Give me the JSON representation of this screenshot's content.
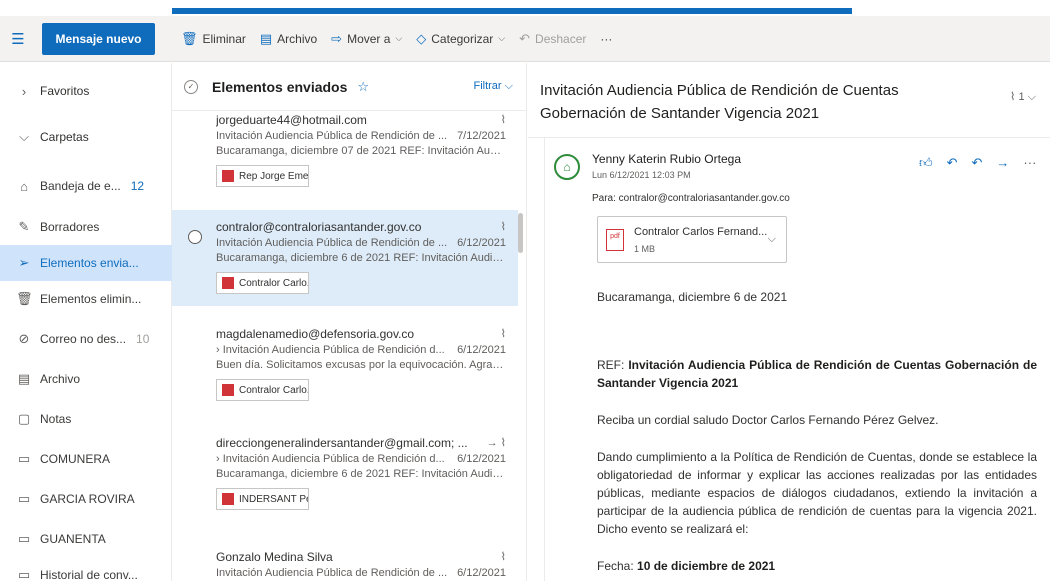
{
  "toolbar": {
    "new_message": "Mensaje nuevo",
    "delete": "Eliminar",
    "archive": "Archivo",
    "move_to": "Mover a",
    "categorize": "Categorizar",
    "undo": "Deshacer",
    "more": "···"
  },
  "sidebar": {
    "favorites": "Favoritos",
    "folders": "Carpetas",
    "items": [
      {
        "label": "Bandeja de e...",
        "count": "12",
        "icon": "inbox-icon"
      },
      {
        "label": "Borradores",
        "count": "",
        "icon": "pencil-icon"
      },
      {
        "label": "Elementos envia...",
        "count": "",
        "icon": "send-icon"
      },
      {
        "label": "Elementos elimin...",
        "count": "",
        "icon": "trash-icon"
      },
      {
        "label": "Correo no des...",
        "count": "10",
        "icon": "block-icon"
      },
      {
        "label": "Archivo",
        "count": "",
        "icon": "archive-icon"
      },
      {
        "label": "Notas",
        "count": "",
        "icon": "note-icon"
      },
      {
        "label": "COMUNERA",
        "count": "",
        "icon": "folder-icon"
      },
      {
        "label": "GARCIA ROVIRA",
        "count": "",
        "icon": "folder-icon"
      },
      {
        "label": "GUANENTA",
        "count": "",
        "icon": "folder-icon"
      },
      {
        "label": "Historial de conv...",
        "count": "",
        "icon": "folder-icon"
      }
    ]
  },
  "list": {
    "title": "Elementos enviados",
    "filter": "Filtrar",
    "messages": [
      {
        "sender": "jorgeduarte44@hotmail.com",
        "subject": "Invitación Audiencia Pública de Rendición de ...",
        "date": "7/12/2021",
        "preview": "Bucaramanga, diciembre 07 de 2021 REF: Invitación Audi...",
        "attachment": "Rep Jorge Emes..."
      },
      {
        "sender": "contralor@contraloriasantander.gov.co",
        "subject": "Invitación Audiencia Pública de Rendición de ...",
        "date": "6/12/2021",
        "preview": "Bucaramanga, diciembre 6 de 2021 REF: Invitación Audie...",
        "attachment": "Contralor Carlo..."
      },
      {
        "sender": "magdalenamedio@defensoria.gov.co",
        "subject": "› Invitación Audiencia Pública de Rendición d...",
        "date": "6/12/2021",
        "preview": "Buen día. Solicitamos excusas por la equivocación. Agrad...",
        "attachment": "Contralor Carlo..."
      },
      {
        "sender": "direcciongeneralindersantander@gmail.com; ...",
        "subject": "› Invitación Audiencia Pública de Rendición d...",
        "date": "6/12/2021",
        "preview": "Bucaramanga, diciembre 6 de 2021 REF: Invitación Audie...",
        "attachment": "INDERSANT Pe..."
      },
      {
        "sender": "Gonzalo Medina Silva",
        "subject": "Invitación Audiencia Pública de Rendición de ...",
        "date": "6/12/2021",
        "preview": "",
        "attachment": ""
      }
    ]
  },
  "reading": {
    "title": "Invitación Audiencia Pública de Rendición de Cuentas Gobernación de Santander Vigencia 2021",
    "attach_count": "1",
    "from": "Yenny Katerin Rubio Ortega",
    "date": "Lun 6/12/2021 12:03 PM",
    "to": "Para: contralor@contraloriasantander.gov.co",
    "attachment_name": "Contralor Carlos Fernand...",
    "attachment_size": "1 MB",
    "body": {
      "greeting": "Bucaramanga, diciembre 6 de 2021",
      "ref_label": "REF: ",
      "ref_text": "Invitación Audiencia Pública de Rendición de Cuentas Gobernación de Santander Vigencia 2021",
      "salute": "Reciba un cordial saludo Doctor Carlos Fernando Pérez Gelvez.",
      "paragraph": "Dando cumplimiento a la Política de Rendición de Cuentas, donde se establece la obligatoriedad de informar y explicar las acciones realizadas por las entidades públicas, mediante espacios de diálogos ciudadanos, extiendo la invitación a participar de la audiencia pública de rendición de cuentas para la vigencia 2021. Dicho evento se realizará el:",
      "fecha_label": "Fecha: ",
      "fecha_value": "10 de diciembre de 2021"
    }
  },
  "colors": {
    "accent": "#0f6cbd",
    "selected_bg": "#deecf9",
    "active_folder_bg": "#cfe4fa"
  }
}
